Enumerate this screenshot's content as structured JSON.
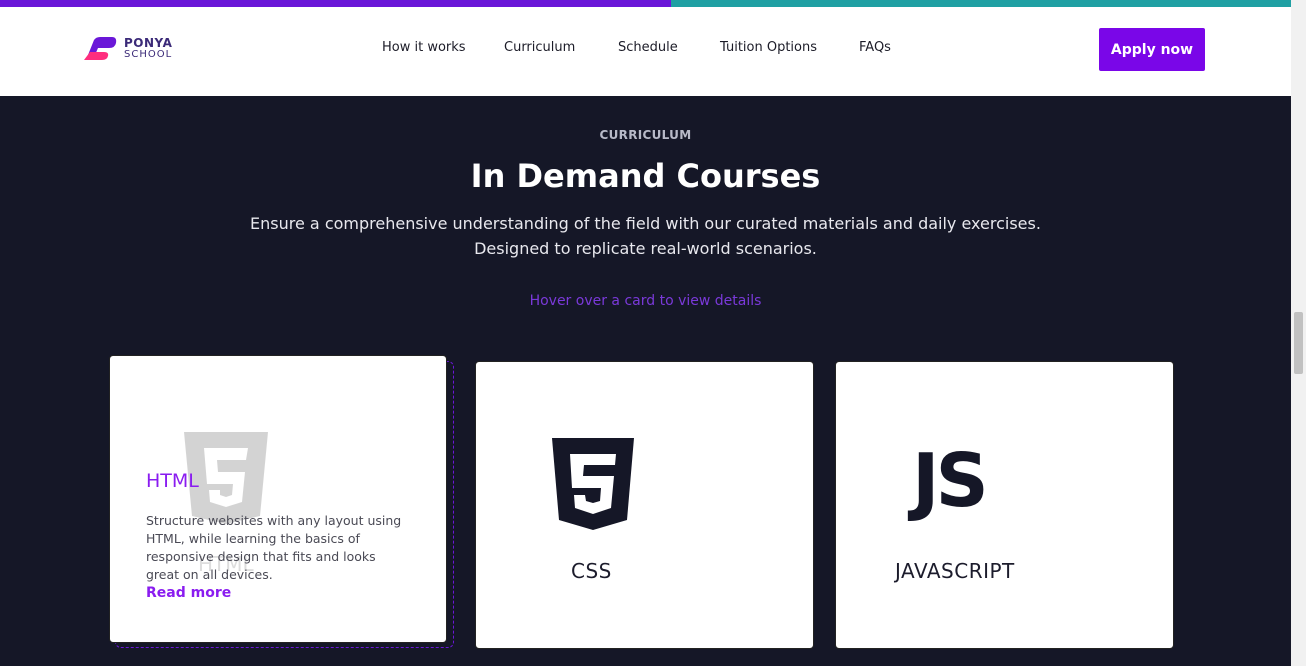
{
  "progress": {
    "fraction": 0.52
  },
  "header": {
    "logo": {
      "line1": "PONYA",
      "line2": "SCHOOL"
    },
    "nav": [
      {
        "label": "How it works"
      },
      {
        "label": "Curriculum"
      },
      {
        "label": "Schedule"
      },
      {
        "label": "Tuition Options"
      },
      {
        "label": "FAQs"
      }
    ],
    "cta": "Apply now"
  },
  "section": {
    "eyebrow": "CURRICULUM",
    "title": "In Demand Courses",
    "subtitle_line1": "Ensure a comprehensive understanding of the field with our curated materials and daily exercises.",
    "subtitle_line2": "Designed to replicate real-world scenarios.",
    "hint": "Hover over a card to view details"
  },
  "cards": [
    {
      "title": "HTML",
      "watermark": "HTML",
      "icon": "html5-icon",
      "description": "Structure websites with any layout using HTML, while learning the basics of responsive design that fits and looks great on all devices.",
      "link": "Read more"
    },
    {
      "title": "CSS",
      "icon": "css3-icon"
    },
    {
      "title": "JAVASCRIPT",
      "icon": "js-icon",
      "glyph": "JS"
    }
  ],
  "colors": {
    "accent": "#7a06e8",
    "progress": "#6a17d8",
    "track": "#1fa0a3",
    "background": "#151727"
  }
}
